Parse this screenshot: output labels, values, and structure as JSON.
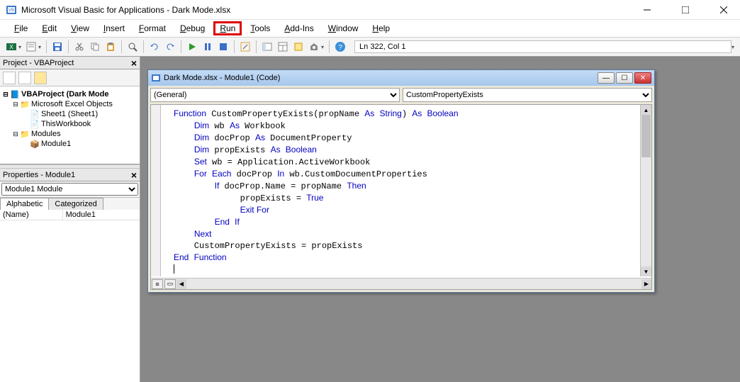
{
  "window": {
    "title": "Microsoft Visual Basic for Applications - Dark Mode.xlsx"
  },
  "menu": {
    "items": [
      "File",
      "Edit",
      "View",
      "Insert",
      "Format",
      "Debug",
      "Run",
      "Tools",
      "Add-Ins",
      "Window",
      "Help"
    ],
    "highlighted": "Run"
  },
  "toolbar": {
    "status": "Ln 322, Col 1"
  },
  "project_panel": {
    "title": "Project - VBAProject",
    "tree": {
      "root": "VBAProject (Dark Mode",
      "group1": "Microsoft Excel Objects",
      "sheet1": "Sheet1 (Sheet1)",
      "workbook": "ThisWorkbook",
      "group2": "Modules",
      "module": "Module1"
    }
  },
  "properties_panel": {
    "title": "Properties - Module1",
    "combo": "Module1 Module",
    "tabs": {
      "alphabetic": "Alphabetic",
      "categorized": "Categorized"
    },
    "rows": [
      {
        "name": "(Name)",
        "value": "Module1"
      }
    ]
  },
  "code_window": {
    "title": "Dark Mode.xlsx - Module1 (Code)",
    "combo_left": "(General)",
    "combo_right": "CustomPropertyExists",
    "lines": [
      {
        "indent": 0,
        "tokens": [
          [
            "kw",
            "Function"
          ],
          [
            "",
            " CustomPropertyExists(propName "
          ],
          [
            "kw",
            "As"
          ],
          [
            "",
            " "
          ],
          [
            "kw",
            "String"
          ],
          [
            "",
            ") "
          ],
          [
            "kw",
            "As"
          ],
          [
            "",
            " "
          ],
          [
            "kw",
            "Boolean"
          ]
        ]
      },
      {
        "indent": 1,
        "tokens": [
          [
            "kw",
            "Dim"
          ],
          [
            "",
            " wb "
          ],
          [
            "kw",
            "As"
          ],
          [
            "",
            " Workbook"
          ]
        ]
      },
      {
        "indent": 1,
        "tokens": [
          [
            "kw",
            "Dim"
          ],
          [
            "",
            " docProp "
          ],
          [
            "kw",
            "As"
          ],
          [
            "",
            " DocumentProperty"
          ]
        ]
      },
      {
        "indent": 1,
        "tokens": [
          [
            "kw",
            "Dim"
          ],
          [
            "",
            " propExists "
          ],
          [
            "kw",
            "As"
          ],
          [
            "",
            " "
          ],
          [
            "kw",
            "Boolean"
          ]
        ]
      },
      {
        "indent": 1,
        "tokens": [
          [
            "kw",
            "Set"
          ],
          [
            "",
            " wb = Application.ActiveWorkbook"
          ]
        ]
      },
      {
        "indent": 1,
        "tokens": [
          [
            "kw",
            "For"
          ],
          [
            "",
            " "
          ],
          [
            "kw",
            "Each"
          ],
          [
            "",
            " docProp "
          ],
          [
            "kw",
            "In"
          ],
          [
            "",
            " wb.CustomDocumentProperties"
          ]
        ]
      },
      {
        "indent": 2,
        "tokens": [
          [
            "kw",
            "If"
          ],
          [
            "",
            " docProp.Name = propName "
          ],
          [
            "kw",
            "Then"
          ]
        ]
      },
      {
        "indent": 3,
        "tokens": [
          [
            "",
            " propExists = "
          ],
          [
            "kw",
            "True"
          ]
        ]
      },
      {
        "indent": 3,
        "tokens": [
          [
            "",
            " "
          ],
          [
            "kw",
            "Exit For"
          ]
        ]
      },
      {
        "indent": 2,
        "tokens": [
          [
            "kw",
            "End"
          ],
          [
            "",
            " "
          ],
          [
            "kw",
            "If"
          ]
        ]
      },
      {
        "indent": 1,
        "tokens": [
          [
            "kw",
            "Next"
          ]
        ]
      },
      {
        "indent": 1,
        "tokens": [
          [
            "",
            "CustomPropertyExists = propExists"
          ]
        ]
      },
      {
        "indent": 0,
        "tokens": [
          [
            "kw",
            "End"
          ],
          [
            "",
            " "
          ],
          [
            "kw",
            "Function"
          ]
        ]
      }
    ]
  }
}
